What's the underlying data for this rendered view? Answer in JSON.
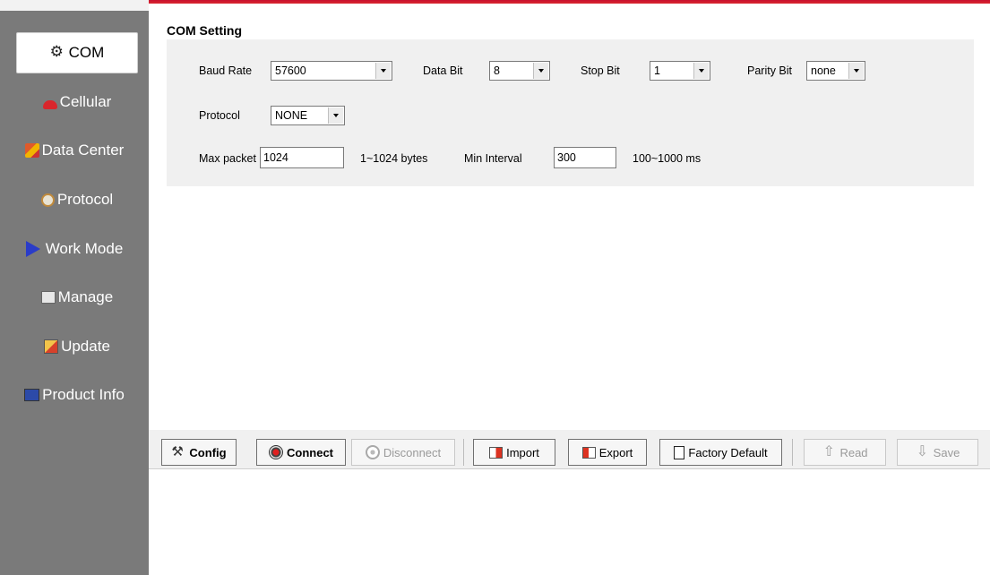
{
  "sidebar": {
    "items": [
      {
        "label": "COM",
        "icon": "com-port-icon",
        "active": true
      },
      {
        "label": "Cellular",
        "icon": "phone-icon",
        "active": false
      },
      {
        "label": "Data Center",
        "icon": "data-center-icon",
        "active": false
      },
      {
        "label": "Protocol",
        "icon": "protocol-icon",
        "active": false
      },
      {
        "label": "Work Mode",
        "icon": "arrow-icon",
        "active": false
      },
      {
        "label": "Manage",
        "icon": "manage-icon",
        "active": false
      },
      {
        "label": "Update",
        "icon": "update-icon",
        "active": false
      },
      {
        "label": "Product Info",
        "icon": "product-info-icon",
        "active": false
      }
    ]
  },
  "settings": {
    "title": "COM Setting",
    "baud_rate": {
      "label": "Baud Rate",
      "value": "57600"
    },
    "data_bit": {
      "label": "Data Bit",
      "value": "8"
    },
    "stop_bit": {
      "label": "Stop Bit",
      "value": "1"
    },
    "parity_bit": {
      "label": "Parity Bit",
      "value": "none"
    },
    "protocol": {
      "label": "Protocol",
      "value": "NONE"
    },
    "max_packet": {
      "label": "Max packet",
      "value": "1024",
      "range": "1~1024 bytes"
    },
    "min_interval": {
      "label": "Min Interval",
      "value": "300",
      "range": "100~1000 ms"
    }
  },
  "toolbar": {
    "config": "Config",
    "connect": "Connect",
    "disconnect": "Disconnect",
    "import": "Import",
    "export": "Export",
    "factory_default": "Factory Default",
    "read": "Read",
    "save": "Save"
  },
  "colors": {
    "accent_red": "#c8102e",
    "sidebar_bg": "#7a7a7a",
    "panel_bg": "#f0f0f0",
    "disabled_text": "#9a9a9a"
  }
}
